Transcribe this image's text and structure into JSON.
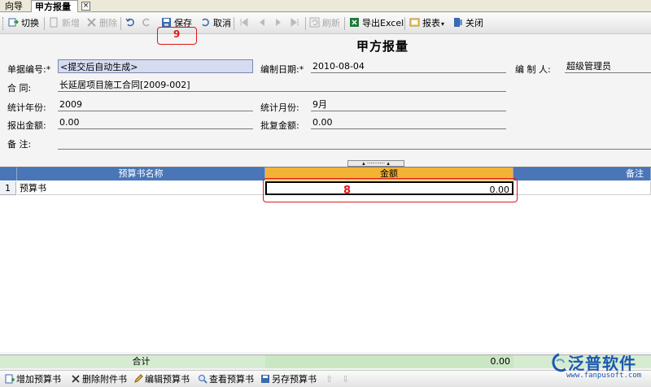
{
  "tabs": {
    "nav": "向导",
    "active": "甲方报量",
    "close": "×"
  },
  "toolbar": {
    "switch": "切换",
    "add": "新增",
    "delete": "删除",
    "save": "保存",
    "cancel": "取消",
    "refresh": "刷新",
    "export": "导出Excel",
    "report": "报表",
    "close": "关闭",
    "save_badge": "9"
  },
  "form": {
    "title": "甲方报量",
    "doc_no_label": "单据编号:*",
    "doc_no_value": "<提交后自动生成>",
    "date_label": "编制日期:*",
    "date_value": "2010-08-04",
    "maker_label": "编 制 人:",
    "maker_value": "超级管理员",
    "contract_label": "合    同:",
    "contract_value": "长延居项目施工合同[2009-002]",
    "year_label": "统计年份:",
    "year_value": "2009",
    "month_label": "统计月份:",
    "month_value": "9月",
    "report_amount_label": "报出金额:",
    "report_amount_value": "0.00",
    "approved_amount_label": "批复金额:",
    "approved_amount_value": "0.00",
    "remark_label": "备    注:",
    "remark_value": ""
  },
  "grid": {
    "columns": [
      "预算书名称",
      "金额",
      "备注"
    ],
    "rows": [
      {
        "num": "1",
        "name": "预算书",
        "amount": "0.00",
        "remark": ""
      }
    ],
    "amount_badge": "8"
  },
  "totals": {
    "label": "合计",
    "amount": "0.00"
  },
  "bottombar": {
    "add_budget": "增加预算书",
    "delete_attachment": "删除附件书",
    "edit_budget": "编辑预算书",
    "view_budget": "查看预算书",
    "saveas_budget": "另存预算书"
  },
  "logo": {
    "name": "泛普软件",
    "url": "www.fanpusoft.com"
  },
  "colors": {
    "header_blue": "#4a76b8",
    "active_col": "#f2b335",
    "total_green": "#d5ecd0",
    "annotation": "#e01818"
  }
}
